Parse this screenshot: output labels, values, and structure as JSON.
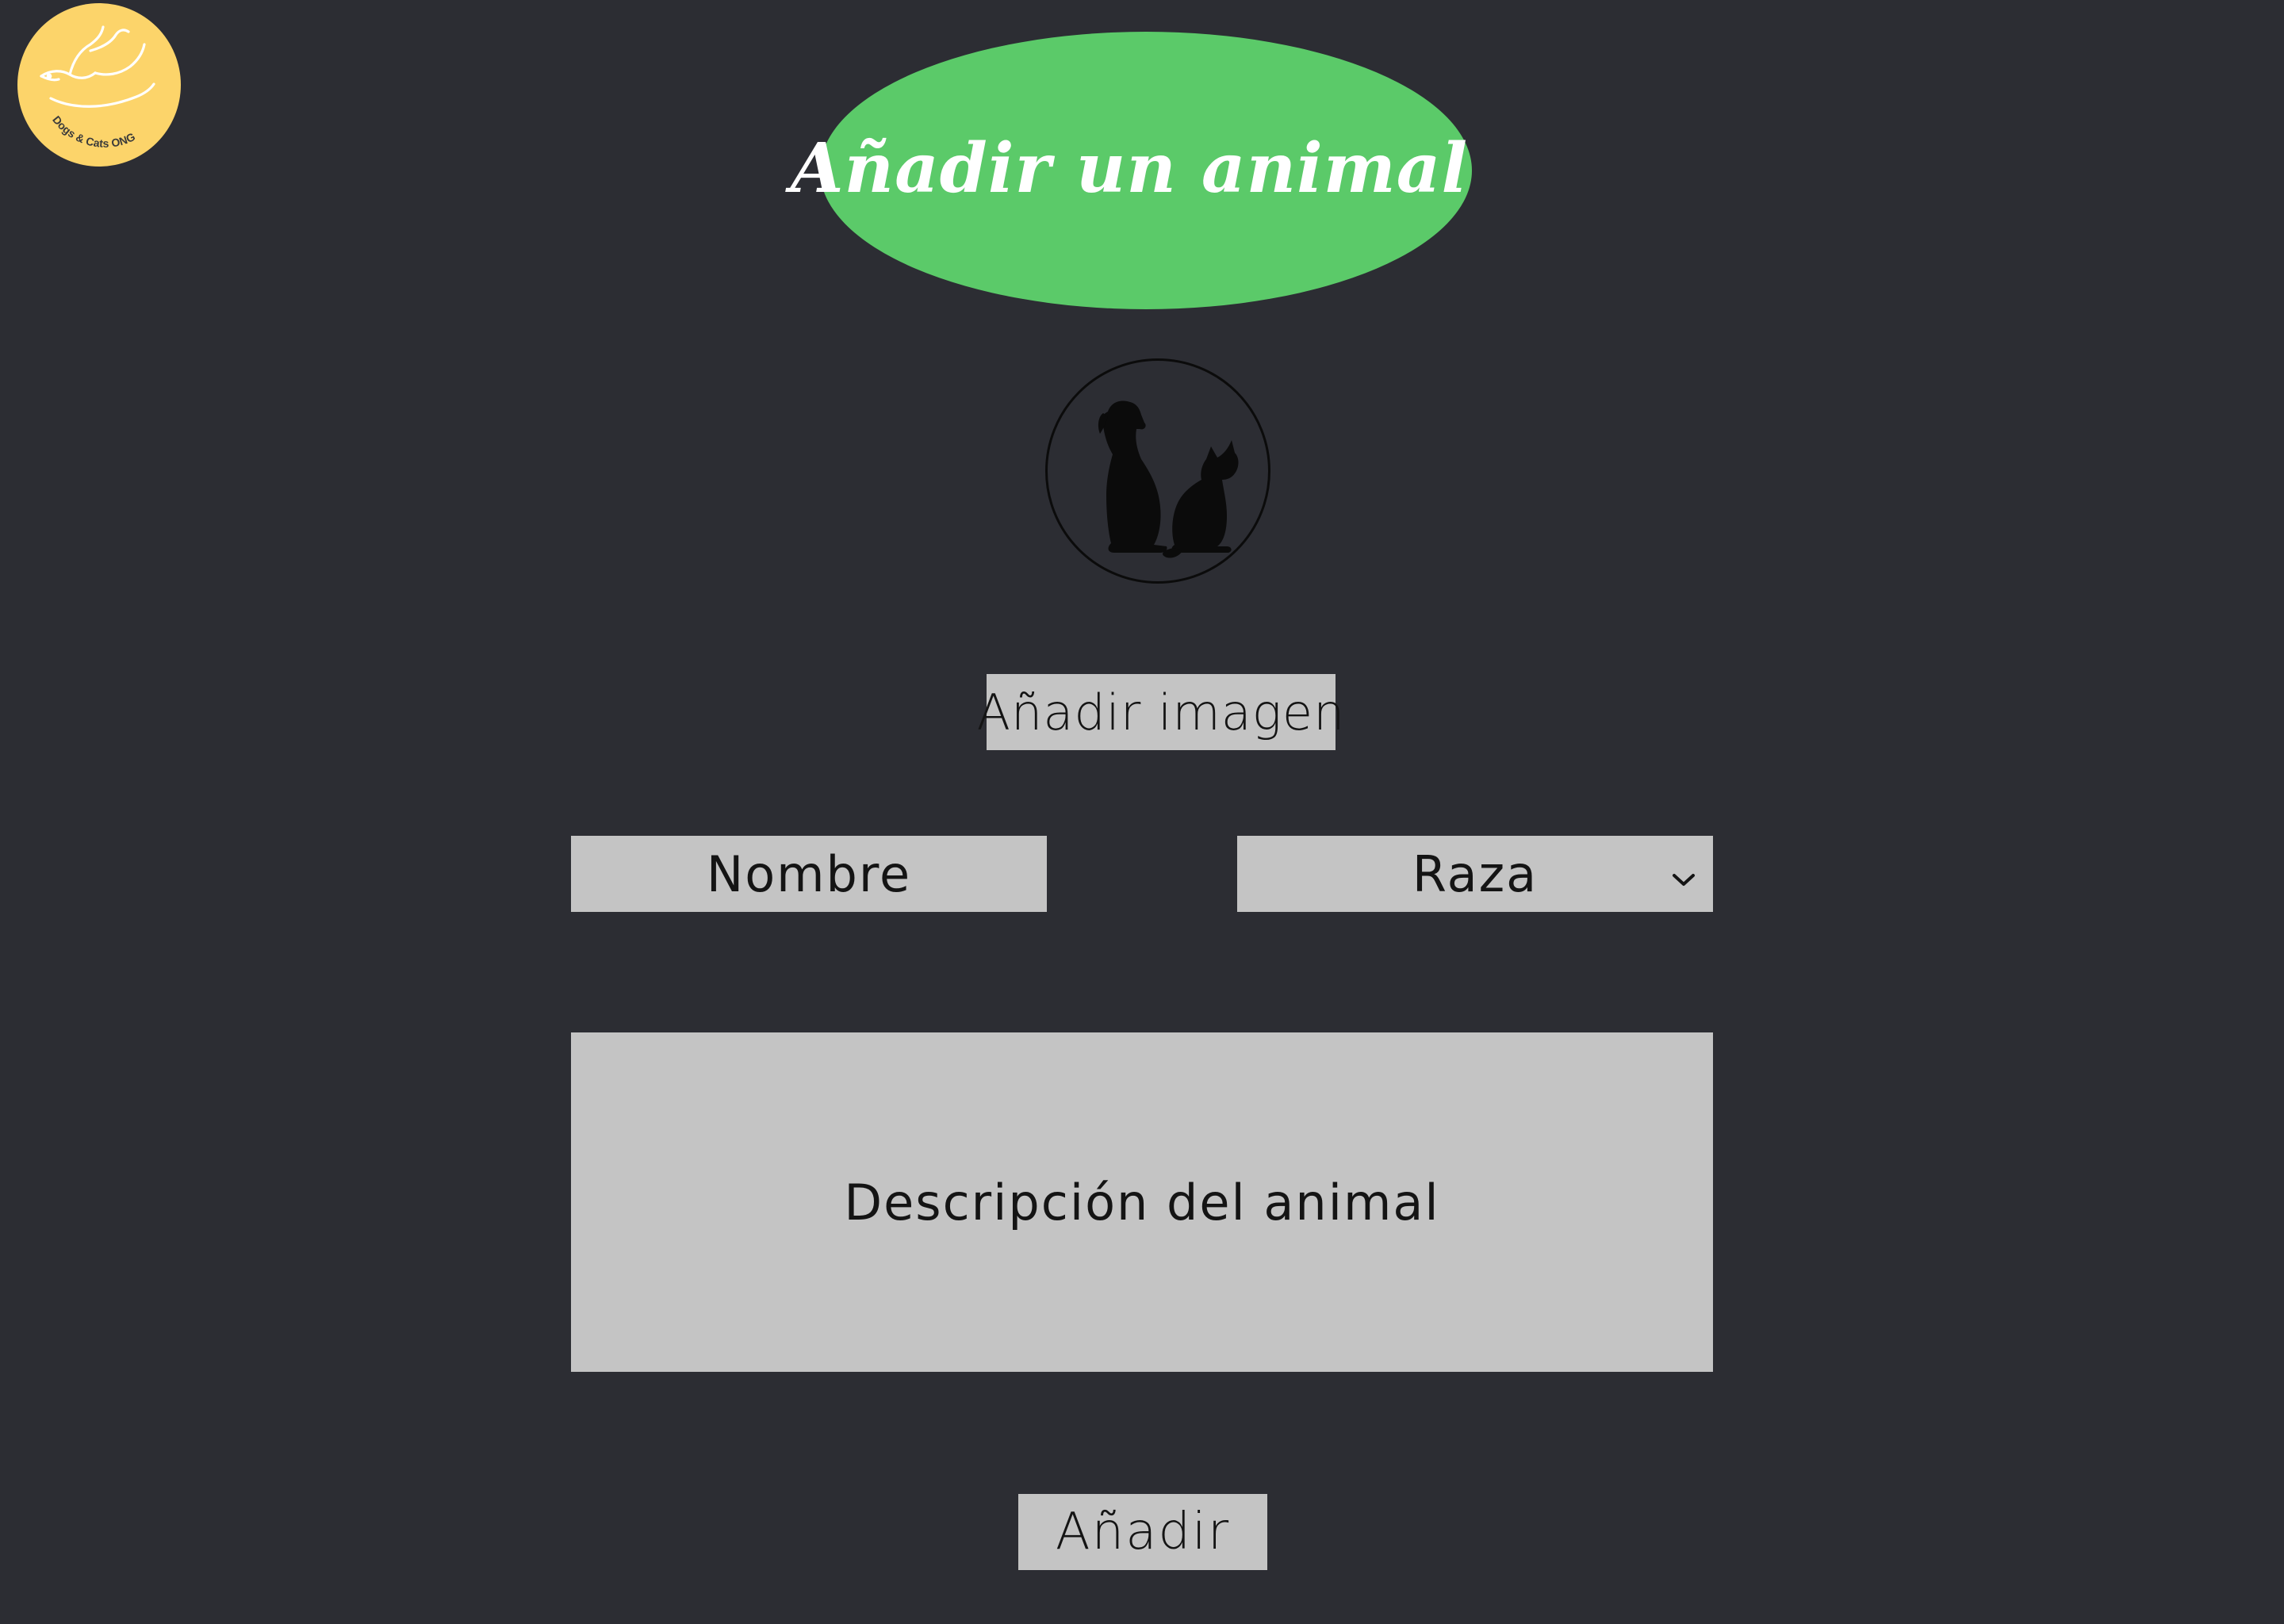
{
  "logo": {
    "icon": "dove-icon",
    "text": "Dogs & Cats ONG",
    "color": "#fcd46a"
  },
  "header": {
    "title": "Añadir un animal",
    "pill_color": "#5bca69"
  },
  "animal_image": {
    "icon": "dog-and-cat-silhouette-icon"
  },
  "form": {
    "add_image_label": "Añadir imagen",
    "name_placeholder": "Nombre",
    "breed_placeholder": "Raza",
    "breed_icon": "chevron-down-icon",
    "description_placeholder": "Descripción del animal",
    "submit_label": "Añadir"
  },
  "colors": {
    "background": "#2c2d33",
    "field": "#c4c4c4",
    "text": "#141414"
  }
}
